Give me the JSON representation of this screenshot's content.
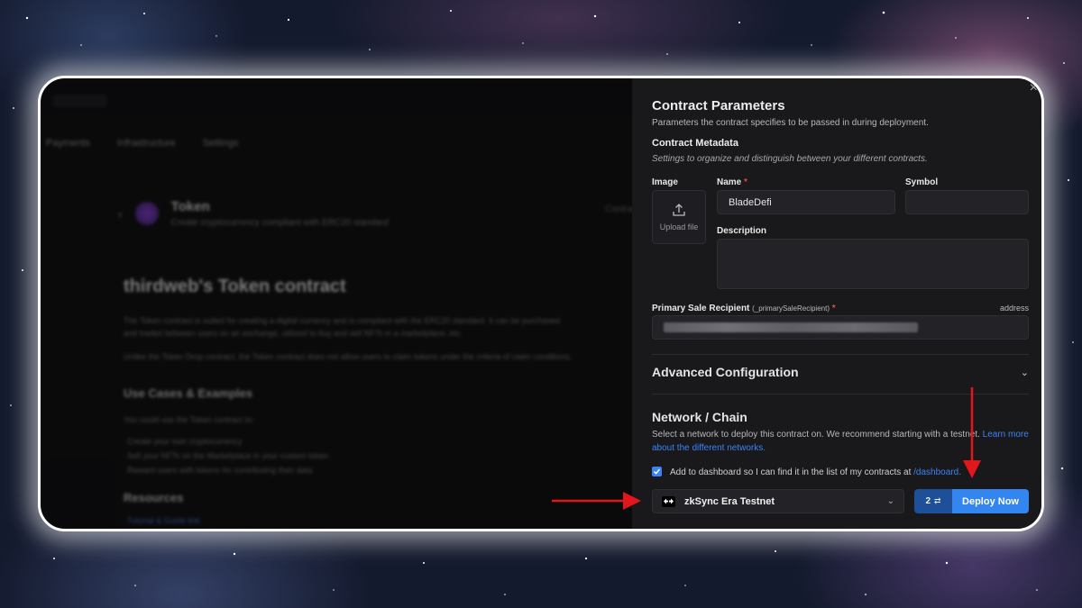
{
  "background_left": {
    "nav": [
      "Payments",
      "Infrastructure",
      "Settings"
    ],
    "token_name": "Token",
    "token_subtitle": "Create cryptocurrency compliant with ERC20 standard",
    "heading": "thirdweb's Token contract",
    "paragraph_1": "The Token contract is suited for creating a digital currency and is compliant with the ERC20 standard. It can be purchased and traded between users on an exchange, utilized to buy and sell NFTs in a marketplace, etc.",
    "paragraph_2": "Unlike the Token Drop contract, the Token contract does not allow users to claim tokens under the criteria of claim conditions.",
    "use_cases_heading": "Use Cases & Examples",
    "use_cases_intro": "You could use the Token contract to:",
    "use_cases": [
      "Create your own cryptocurrency",
      "Sell your NFTs on the Marketplace in your custom token",
      "Reward users with tokens for contributing their data"
    ],
    "resources_heading": "Resources",
    "resources_link": "Tutorial & Guide link",
    "tab_label": "Contract"
  },
  "panel": {
    "title": "Contract Parameters",
    "subtitle": "Parameters the contract specifies to be passed in during deployment.",
    "metadata_title": "Contract Metadata",
    "metadata_subtitle": "Settings to organize and distinguish between your different contracts.",
    "image_label": "Image",
    "upload_label": "Upload file",
    "name_label": "Name",
    "name_value": "BladeDefi",
    "symbol_label": "Symbol",
    "symbol_value": "",
    "description_label": "Description",
    "description_value": "",
    "recipient_label": "Primary Sale Recipient",
    "recipient_param": "(_primarySaleRecipient)",
    "recipient_type": "address",
    "required_mark": "*",
    "advanced_title": "Advanced Configuration",
    "network_title": "Network / Chain",
    "network_desc": "Select a network to deploy this contract on. We recommend starting with a testnet.",
    "network_link": "Learn more about the different networks.",
    "dashboard_text": "Add to dashboard so I can find it in the list of my contracts at",
    "dashboard_link": "/dashboard.",
    "dashboard_checked": true,
    "chain_name": "zkSync Era Testnet",
    "tx_count": "2",
    "deploy_label": "Deploy Now"
  },
  "colors": {
    "accent": "#3385f0",
    "annotation_arrow": "#e3161b"
  }
}
